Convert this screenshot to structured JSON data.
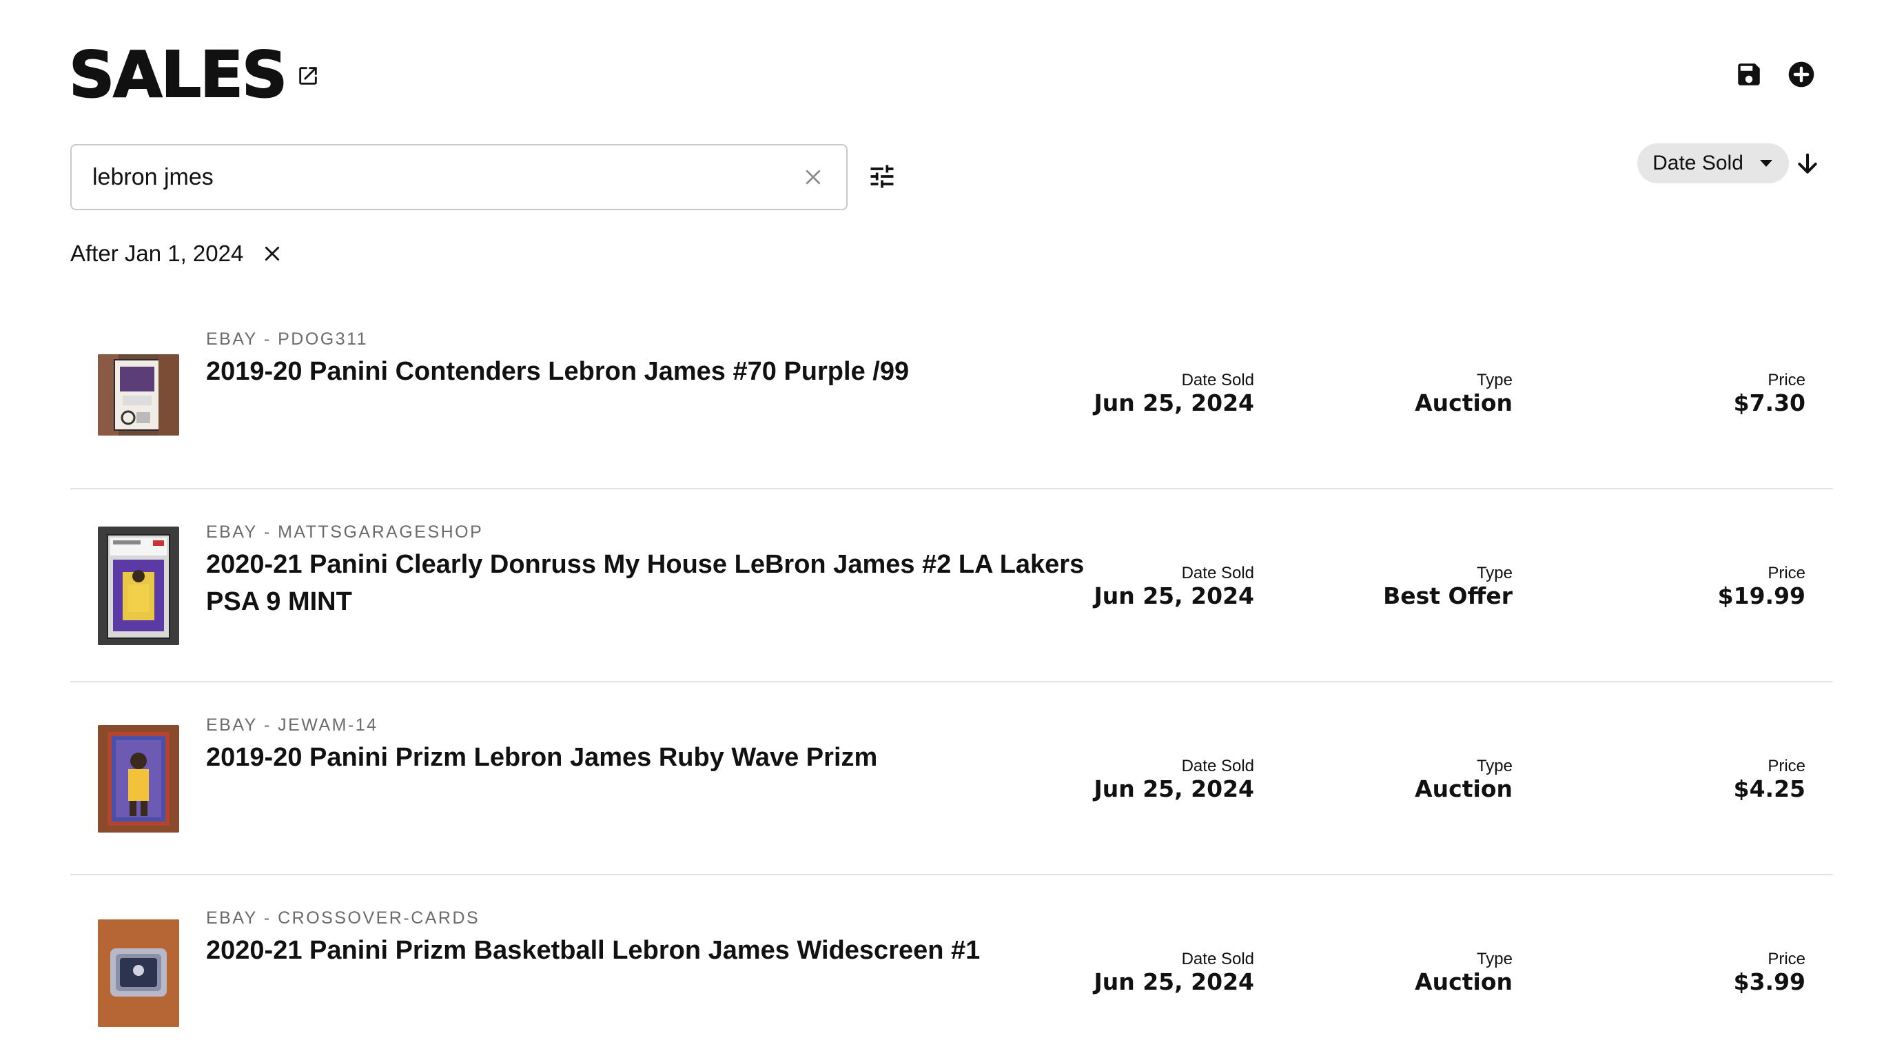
{
  "header": {
    "title": "SALES",
    "external_link_icon": "open-in-new-icon",
    "save_icon": "save-icon",
    "add_icon": "add-circle-icon"
  },
  "search": {
    "value": "lebron jmes",
    "placeholder": "Search sales",
    "clear_icon": "close-icon",
    "filter_icon": "tune-icon"
  },
  "sort": {
    "label": "Date Sold",
    "dropdown_icon": "caret-down-icon",
    "direction_icon": "arrow-down-icon"
  },
  "active_filter": {
    "label": "After Jan 1, 2024",
    "remove_icon": "close-icon"
  },
  "column_labels": {
    "date": "Date Sold",
    "type": "Type",
    "price": "Price"
  },
  "sales": [
    {
      "seller": "EBAY - PDOG311",
      "title": "2019-20 Panini Contenders Lebron James #70 Purple /99",
      "date_sold": "Jun 25, 2024",
      "type": "Auction",
      "price": "$7.30"
    },
    {
      "seller": "EBAY - MATTSGARAGESHOP",
      "title": "2020-21 Panini Clearly Donruss My House LeBron James #2 LA Lakers PSA 9 MINT",
      "date_sold": "Jun 25, 2024",
      "type": "Best Offer",
      "price": "$19.99"
    },
    {
      "seller": "EBAY - JEWAM-14",
      "title": "2019-20 Panini Prizm Lebron James Ruby Wave Prizm",
      "date_sold": "Jun 25, 2024",
      "type": "Auction",
      "price": "$4.25"
    },
    {
      "seller": "EBAY - CROSSOVER-CARDS",
      "title": "2020-21 Panini Prizm Basketball Lebron James Widescreen #1",
      "date_sold": "Jun 25, 2024",
      "type": "Auction",
      "price": "$3.99"
    }
  ]
}
